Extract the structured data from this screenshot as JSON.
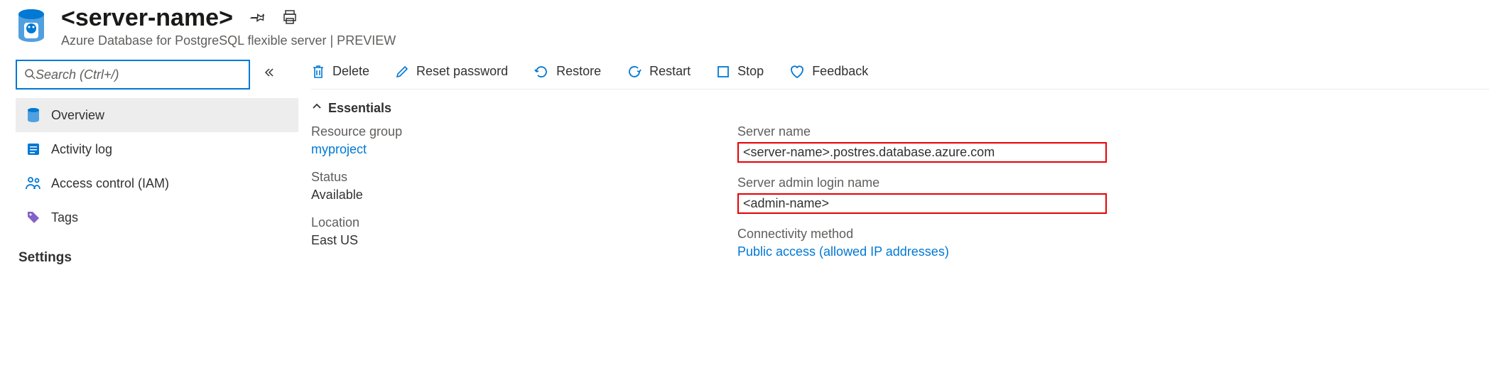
{
  "header": {
    "title": "<server-name>",
    "subtitle": "Azure Database for PostgreSQL flexible server | PREVIEW"
  },
  "search": {
    "placeholder": "Search (Ctrl+/)"
  },
  "nav": {
    "items": [
      {
        "label": "Overview"
      },
      {
        "label": "Activity log"
      },
      {
        "label": "Access control (IAM)"
      },
      {
        "label": "Tags"
      }
    ],
    "settings_header": "Settings"
  },
  "toolbar": {
    "delete": "Delete",
    "reset_password": "Reset password",
    "restore": "Restore",
    "restart": "Restart",
    "stop": "Stop",
    "feedback": "Feedback"
  },
  "essentials": {
    "header": "Essentials",
    "left": {
      "resource_group_label": "Resource group",
      "resource_group_value": "myproject",
      "status_label": "Status",
      "status_value": "Available",
      "location_label": "Location",
      "location_value": "East US"
    },
    "right": {
      "server_name_label": "Server name",
      "server_name_value": "<server-name>.postres.database.azure.com",
      "admin_label": "Server admin login name",
      "admin_value": "<admin-name>",
      "conn_label": "Connectivity method",
      "conn_value": "Public access (allowed IP addresses)"
    }
  }
}
